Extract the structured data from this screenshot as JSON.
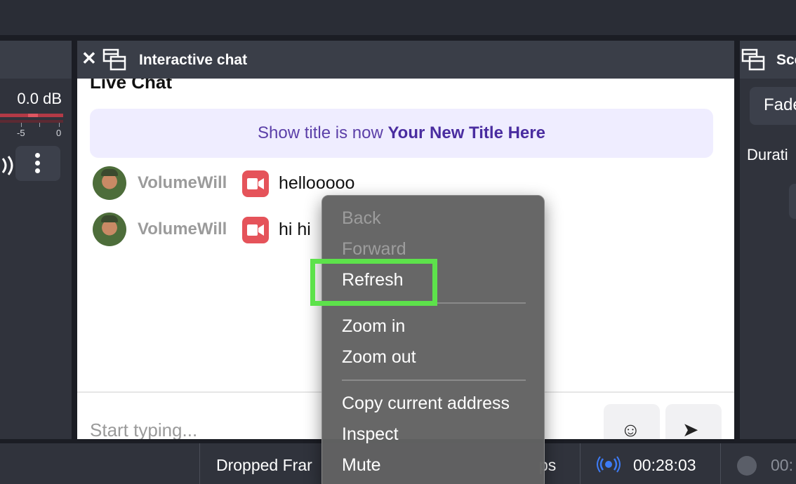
{
  "mixer": {
    "level": "0.0 dB",
    "tick_minus5": "-5",
    "tick_zero": "0"
  },
  "dock": {
    "title": "Interactive chat",
    "heading": "Live Chat",
    "banner_prefix": "Show title is now",
    "banner_title": "Your New Title Here",
    "messages": [
      {
        "user": "VolumeWill",
        "text": "hellooooo"
      },
      {
        "user": "VolumeWill",
        "text": "hi hi"
      }
    ],
    "input_placeholder": "Start typing..."
  },
  "scene_panel": {
    "title": "Sce",
    "transition": "Fade",
    "duration_label": "Durati"
  },
  "statusbar": {
    "dropped_frames": "Dropped Frar",
    "fps_fragment": "ps",
    "stream_time": "00:28:03",
    "record_time": "00:"
  },
  "context_menu": {
    "items": [
      {
        "label": "Back",
        "enabled": false
      },
      {
        "label": "Forward",
        "enabled": false
      },
      {
        "label": "Refresh",
        "enabled": true
      },
      {
        "label": "Zoom in",
        "enabled": true
      },
      {
        "label": "Zoom out",
        "enabled": true
      },
      {
        "label": "Copy current address",
        "enabled": true
      },
      {
        "label": "Inspect",
        "enabled": true
      },
      {
        "label": "Mute",
        "enabled": true
      }
    ]
  },
  "colors": {
    "highlight": "#5de24b",
    "banner_text": "#5b3fa8",
    "cam_badge": "#e5535a",
    "live_indicator": "#3d7bf5"
  },
  "icons": [
    "close-icon",
    "float-window-icon",
    "speaker-icon",
    "kebab-menu-icon",
    "camera-icon",
    "emoji-icon",
    "send-icon",
    "live-broadcast-icon",
    "record-dot-icon"
  ]
}
